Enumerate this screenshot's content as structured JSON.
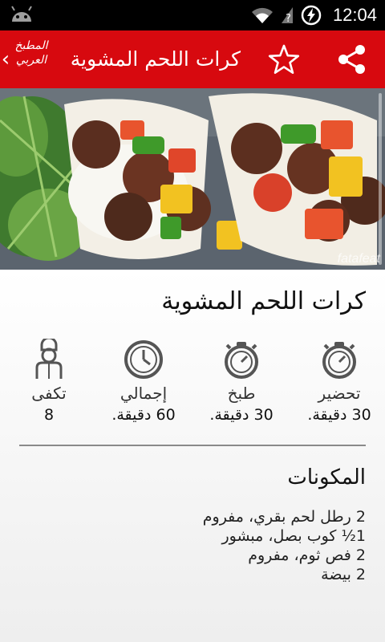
{
  "status_bar": {
    "time": "12:04",
    "icons": [
      "android-icon",
      "wifi-icon",
      "signal-icon",
      "battery-charging-icon"
    ]
  },
  "app_bar": {
    "back_glyph": "‹",
    "logo_text": "المطبخ العربي",
    "title": "كرات اللحم المشوية",
    "icons": [
      "star-icon",
      "share-icon"
    ],
    "color": "#d7090f"
  },
  "hero": {
    "watermark": "fatafeat"
  },
  "recipe": {
    "title": "كرات اللحم المشوية",
    "stats": [
      {
        "label": "تحضير",
        "value": "30 دقيقة.",
        "icon": "stopwatch-icon"
      },
      {
        "label": "طبخ",
        "value": "30 دقيقة.",
        "icon": "stopwatch-icon"
      },
      {
        "label": "إجمالي",
        "value": "60 دقيقة.",
        "icon": "clock-icon"
      },
      {
        "label": "تكفى",
        "value": "8",
        "icon": "chef-icon"
      }
    ],
    "ingredients_title": "المكونات",
    "ingredients": [
      "2 رطل لحم بقري، مفروم",
      "1½ كوب بصل، مبشور",
      "2 فص ثوم، مفروم",
      "2 بيضة"
    ]
  }
}
